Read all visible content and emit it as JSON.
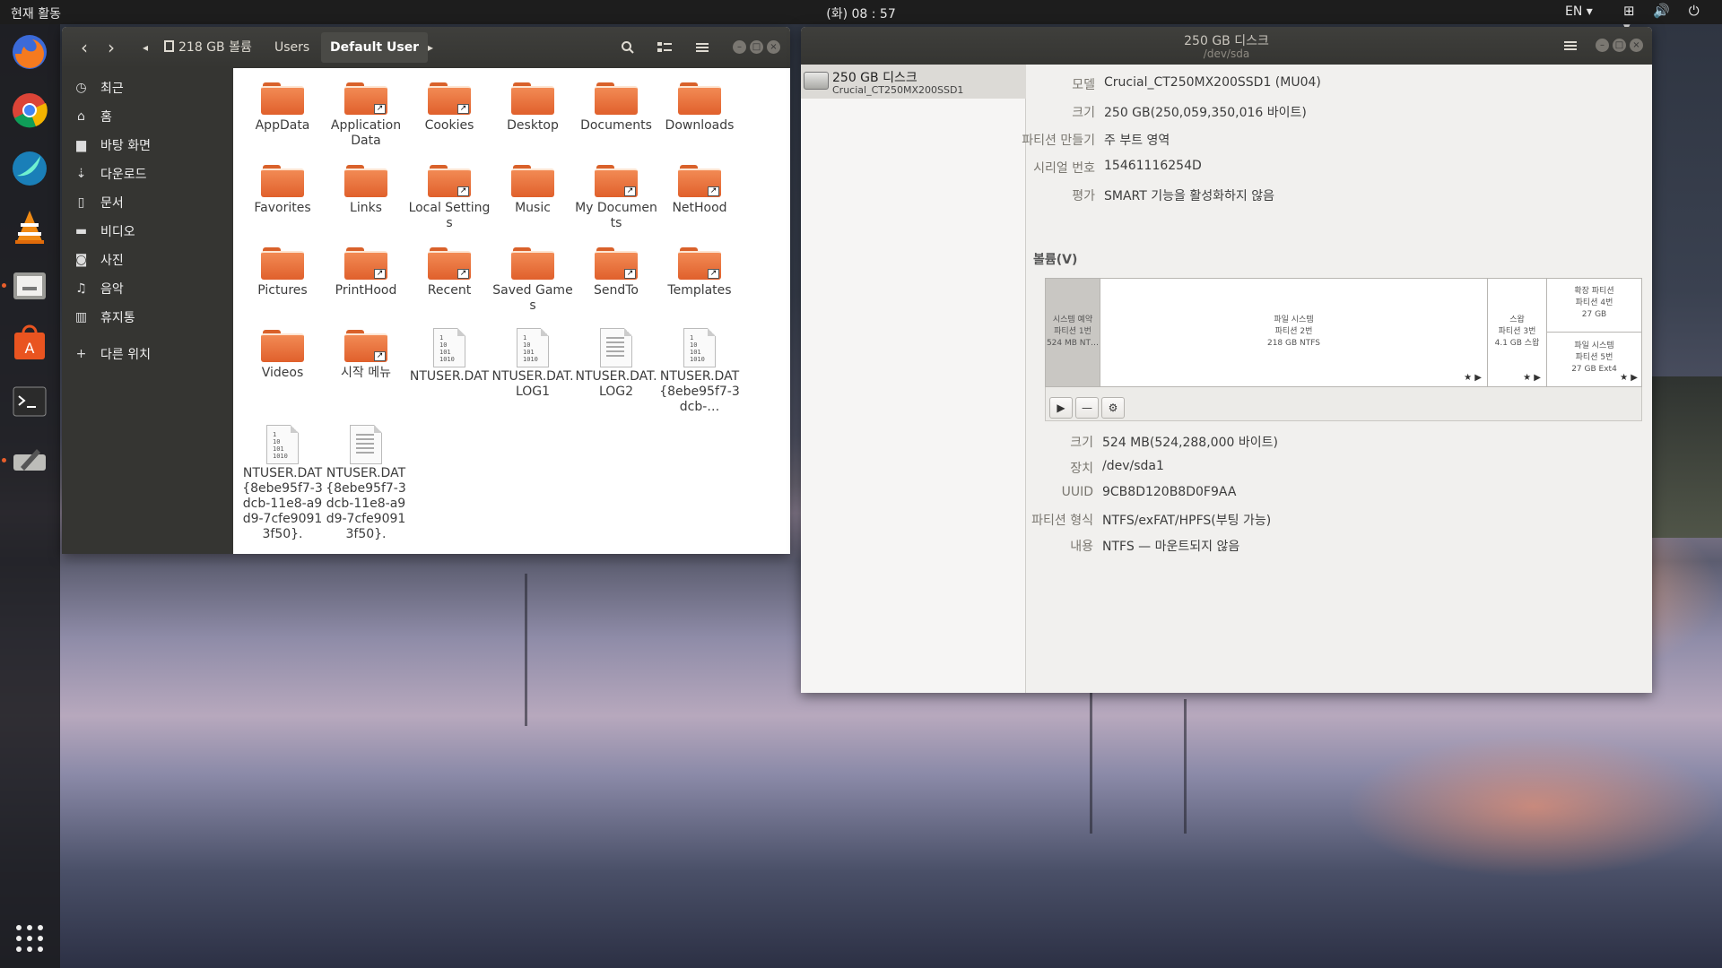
{
  "topbar": {
    "activities": "현재 활동",
    "clock": "(화) 08 : 57",
    "lang": "EN ▾",
    "tray": "⊞ 🔊 ⏻ ▾"
  },
  "dock": {
    "apps": [
      "firefox-icon",
      "chrome-icon",
      "browser-icon",
      "vlc-icon",
      "files-icon",
      "software-center-icon",
      "terminal-icon",
      "disks-icon"
    ],
    "show_apps": "⋮⋮⋮"
  },
  "files": {
    "nav": {
      "back": "‹",
      "forward": "›",
      "left": "◂",
      "right": "▸"
    },
    "breadcrumbs": [
      "218 GB 볼륨",
      "Users",
      "Default User"
    ],
    "sidebar": [
      {
        "icon": "clock-icon",
        "glyph": "◷",
        "label": "최근"
      },
      {
        "icon": "home-icon",
        "glyph": "⌂",
        "label": "홈"
      },
      {
        "icon": "folder-icon",
        "glyph": "▆",
        "label": "바탕 화면"
      },
      {
        "icon": "download-icon",
        "glyph": "⇣",
        "label": "다운로드"
      },
      {
        "icon": "document-icon",
        "glyph": "▯",
        "label": "문서"
      },
      {
        "icon": "video-icon",
        "glyph": "▬",
        "label": "비디오"
      },
      {
        "icon": "camera-icon",
        "glyph": "◙",
        "label": "사진"
      },
      {
        "icon": "music-icon",
        "glyph": "♫",
        "label": "음악"
      },
      {
        "icon": "trash-icon",
        "glyph": "▥",
        "label": "휴지통"
      },
      {
        "icon": "plus-icon",
        "glyph": "+",
        "label": "다른 위치"
      }
    ],
    "items": [
      {
        "name": "AppData",
        "kind": "folder"
      },
      {
        "name": "Application Data",
        "kind": "link"
      },
      {
        "name": "Cookies",
        "kind": "link"
      },
      {
        "name": "Desktop",
        "kind": "folder"
      },
      {
        "name": "Documents",
        "kind": "folder"
      },
      {
        "name": "Downloads",
        "kind": "folder"
      },
      {
        "name": "Favorites",
        "kind": "folder"
      },
      {
        "name": "Links",
        "kind": "folder"
      },
      {
        "name": "Local Settings",
        "kind": "link"
      },
      {
        "name": "Music",
        "kind": "folder"
      },
      {
        "name": "My Documents",
        "kind": "link"
      },
      {
        "name": "NetHood",
        "kind": "link"
      },
      {
        "name": "Pictures",
        "kind": "folder"
      },
      {
        "name": "PrintHood",
        "kind": "link"
      },
      {
        "name": "Recent",
        "kind": "link"
      },
      {
        "name": "Saved Games",
        "kind": "folder"
      },
      {
        "name": "SendTo",
        "kind": "link"
      },
      {
        "name": "Templates",
        "kind": "link"
      },
      {
        "name": "Videos",
        "kind": "folder"
      },
      {
        "name": "시작 메뉴",
        "kind": "link"
      },
      {
        "name": "NTUSER.DAT",
        "kind": "bin"
      },
      {
        "name": "NTUSER.DAT.LOG1",
        "kind": "bin"
      },
      {
        "name": "NTUSER.DAT.LOG2",
        "kind": "txt"
      },
      {
        "name": "NTUSER.DAT{8ebe95f7-3dcb-…",
        "kind": "bin"
      },
      {
        "name": "NTUSER.DAT{8ebe95f7-3dcb-11e8-a9d9-7cfe90913f50}.",
        "kind": "bin"
      },
      {
        "name": "NTUSER.DAT{8ebe95f7-3dcb-11e8-a9d9-7cfe90913f50}.",
        "kind": "txt"
      }
    ],
    "bin_glyph": "1\n10\n101\n1010"
  },
  "disks": {
    "title": "250 GB 디스크",
    "subtitle": "/dev/sda",
    "disk_name": "250 GB 디스크",
    "disk_model": "Crucial_CT250MX200SSD1",
    "info": [
      {
        "k": "모델",
        "v": "Crucial_CT250MX200SSD1 (MU04)"
      },
      {
        "k": "크기",
        "v": "250 GB(250,059,350,016 바이트)"
      },
      {
        "k": "파티션 만들기",
        "v": "주 부트 영역"
      },
      {
        "k": "시리얼 번호",
        "v": "15461116254D"
      },
      {
        "k": "평가",
        "v": "SMART 기능을 활성화하지 않음"
      }
    ],
    "volumes_label": "볼륨(V)",
    "partitions": {
      "p1": "시스템 예약\n파티션 1번\n524 MB NT…",
      "p2": "파일 시스템\n파티션 2번\n218 GB NTFS",
      "p3": "스왑\n파티션 3번\n4.1 GB 스왑",
      "p4": "확장 파티션\n파티션 4번\n27 GB",
      "p5": "파일 시스템\n파티션 5번\n27 GB Ext4"
    },
    "star": "★ ▶",
    "buttons": {
      "play": "▶",
      "minus": "—",
      "gear": "⚙"
    },
    "details": [
      {
        "k": "크기",
        "v": "524 MB(524,288,000 바이트)"
      },
      {
        "k": "장치",
        "v": "/dev/sda1"
      },
      {
        "k": "UUID",
        "v": "9CB8D120B8D0F9AA"
      },
      {
        "k": "파티션 형식",
        "v": "NTFS/exFAT/HPFS(부팅 가능)"
      },
      {
        "k": "내용",
        "v": "NTFS — 마운트되지 않음"
      }
    ]
  }
}
